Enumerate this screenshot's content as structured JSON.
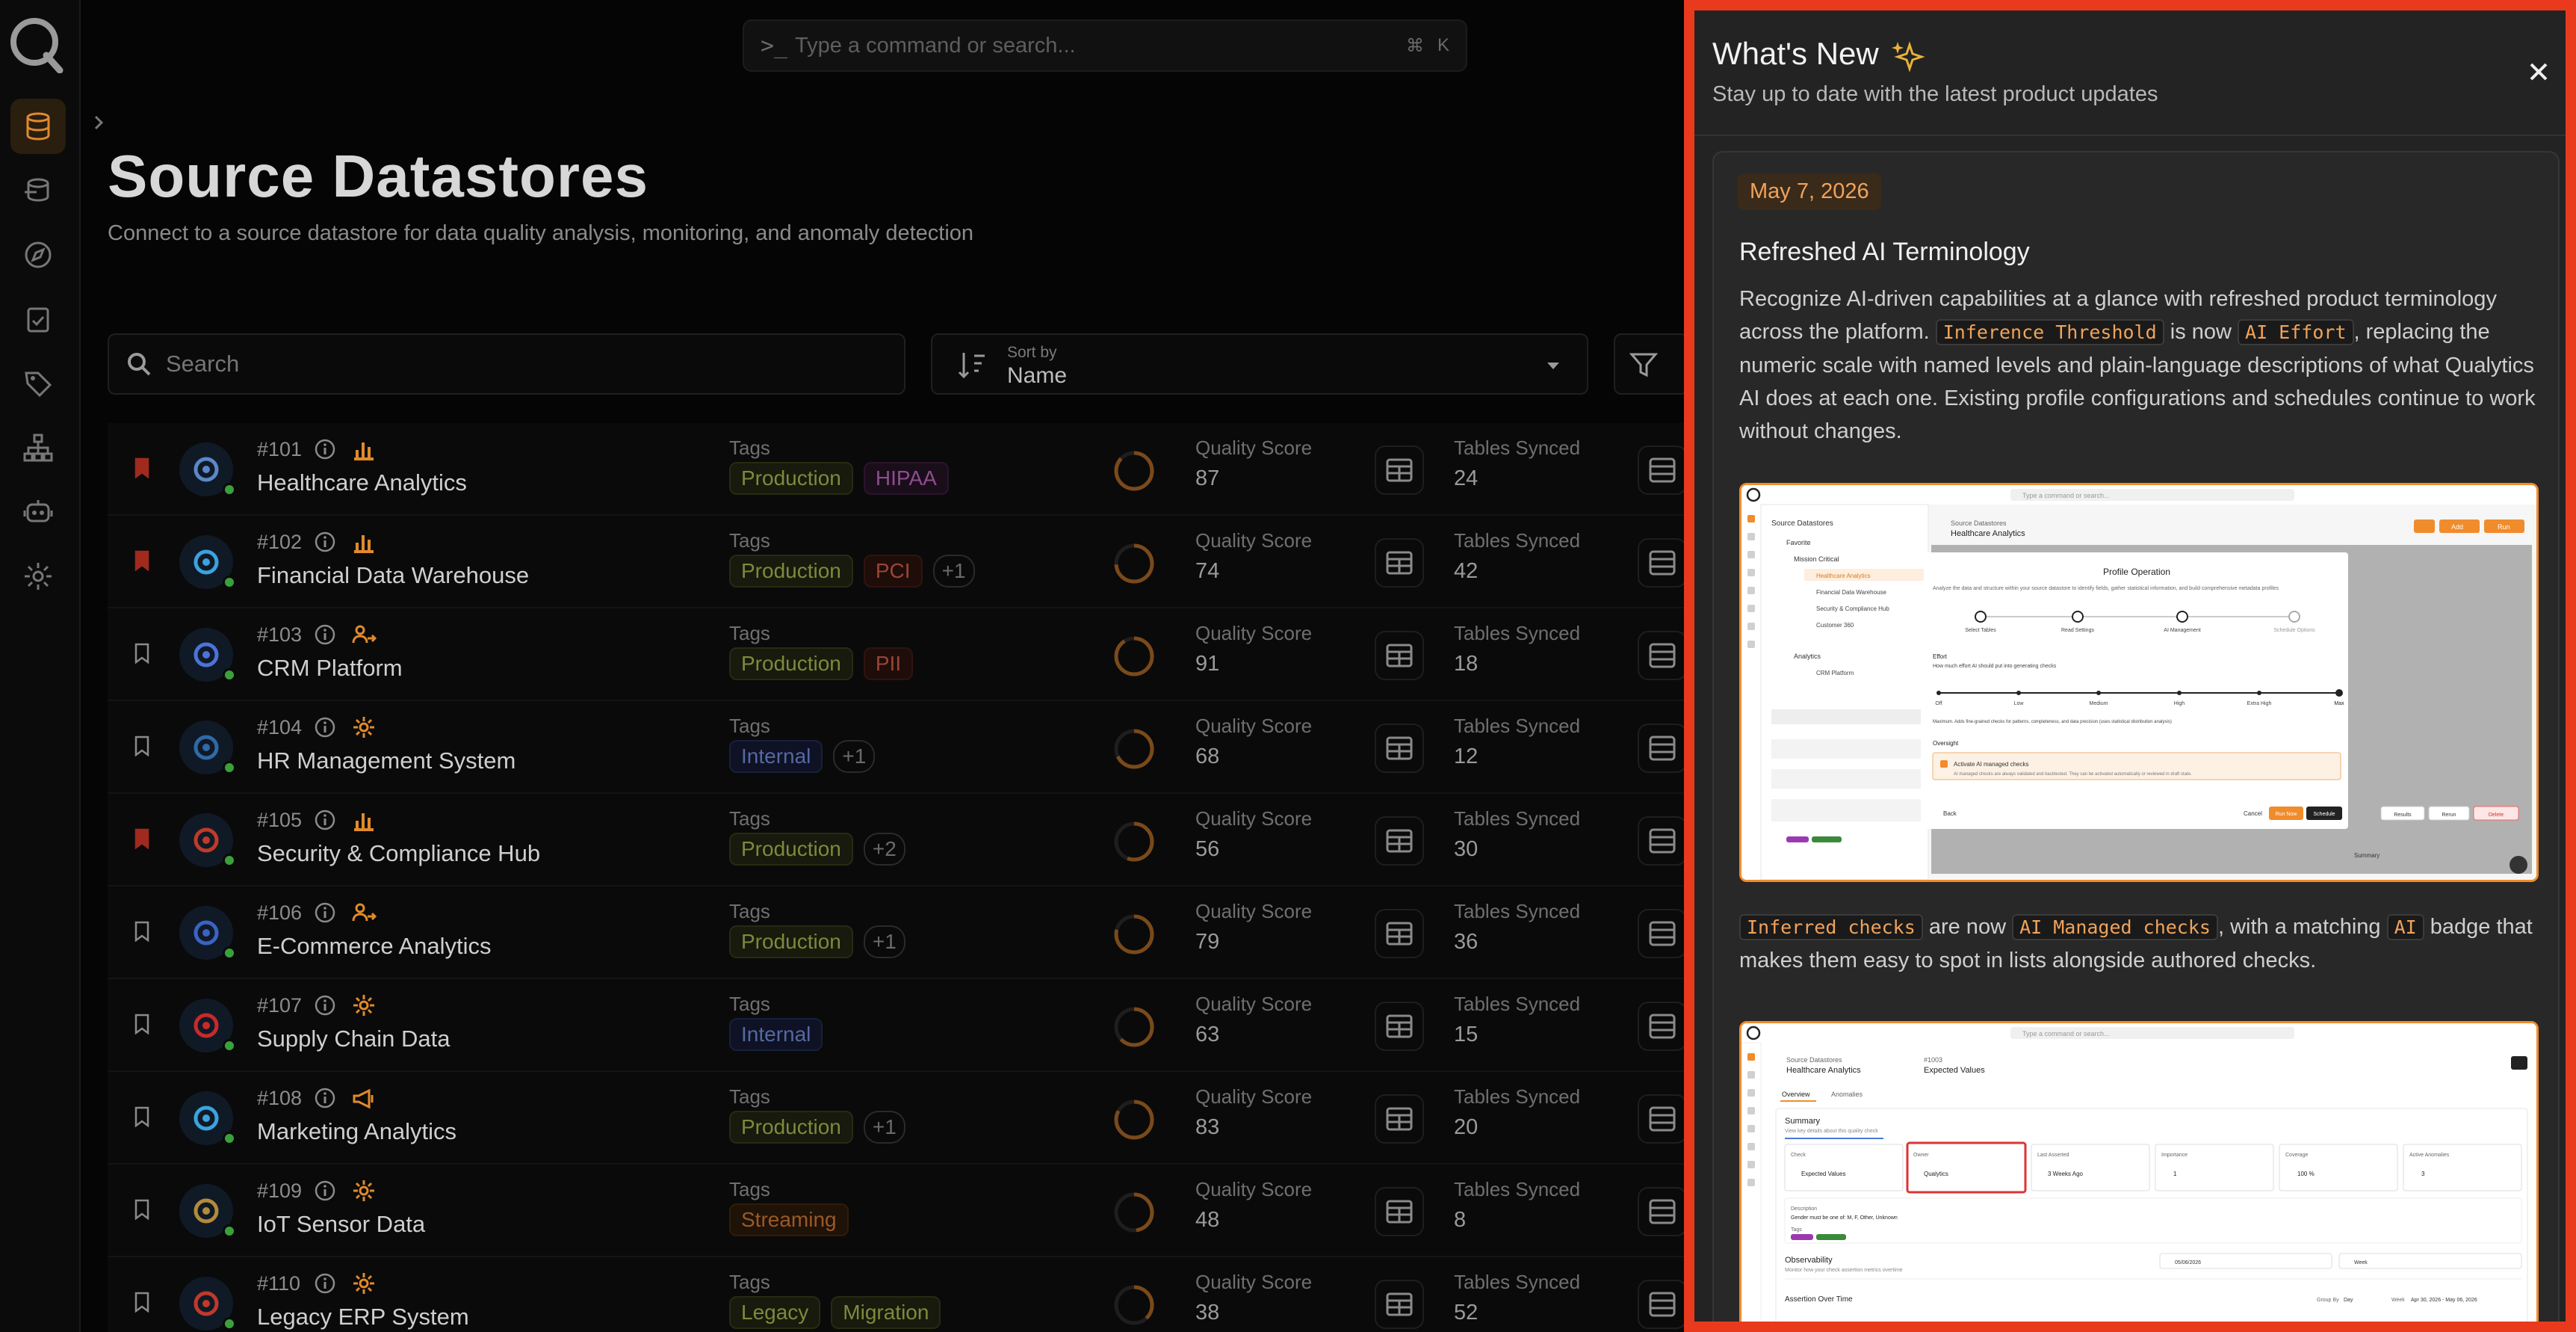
{
  "command_bar": {
    "placeholder": "Type a command or search...",
    "shortcut_mod": "⌘",
    "shortcut_key": "K"
  },
  "header": {
    "title": "Source Datastores",
    "subtitle": "Connect to a source datastore for data quality analysis, monitoring, and anomaly detection"
  },
  "filters": {
    "search_placeholder": "Search",
    "sort_label": "Sort by",
    "sort_value": "Name"
  },
  "labels": {
    "tags": "Tags",
    "quality": "Quality Score",
    "tables": "Tables Synced"
  },
  "datastores": [
    {
      "id": "#101",
      "name": "Healthcare Analytics",
      "bookmarked": true,
      "type_icon": "bar-chart",
      "tags": [
        [
          "Production",
          "green"
        ],
        [
          "HIPAA",
          "pink"
        ]
      ],
      "more": "",
      "quality": "87",
      "tables": "24",
      "logo_color": "#5a88c8"
    },
    {
      "id": "#102",
      "name": "Financial Data Warehouse",
      "bookmarked": true,
      "type_icon": "bar-chart",
      "tags": [
        [
          "Production",
          "green"
        ],
        [
          "PCI",
          "red"
        ]
      ],
      "more": "+1",
      "quality": "74",
      "tables": "42",
      "logo_color": "#3aa3e0"
    },
    {
      "id": "#103",
      "name": "CRM Platform",
      "bookmarked": false,
      "type_icon": "user-share",
      "tags": [
        [
          "Production",
          "green"
        ],
        [
          "PII",
          "red"
        ]
      ],
      "more": "",
      "quality": "91",
      "tables": "18",
      "logo_color": "#4b73d9"
    },
    {
      "id": "#104",
      "name": "HR Management System",
      "bookmarked": false,
      "type_icon": "gear",
      "tags": [
        [
          "Internal",
          "blue"
        ]
      ],
      "more": "+1",
      "quality": "68",
      "tables": "12",
      "logo_color": "#2f6aa8"
    },
    {
      "id": "#105",
      "name": "Security & Compliance Hub",
      "bookmarked": true,
      "type_icon": "bar-chart",
      "tags": [
        [
          "Production",
          "green"
        ]
      ],
      "more": "+2",
      "quality": "56",
      "tables": "30",
      "logo_color": "#c03a2a"
    },
    {
      "id": "#106",
      "name": "E-Commerce Analytics",
      "bookmarked": false,
      "type_icon": "user-share",
      "tags": [
        [
          "Production",
          "green"
        ]
      ],
      "more": "+1",
      "quality": "79",
      "tables": "36",
      "logo_color": "#3b63c4"
    },
    {
      "id": "#107",
      "name": "Supply Chain Data",
      "bookmarked": false,
      "type_icon": "gear",
      "tags": [
        [
          "Internal",
          "blue"
        ]
      ],
      "more": "",
      "quality": "63",
      "tables": "15",
      "logo_color": "#c82a2a"
    },
    {
      "id": "#108",
      "name": "Marketing Analytics",
      "bookmarked": false,
      "type_icon": "megaphone",
      "tags": [
        [
          "Production",
          "green"
        ]
      ],
      "more": "+1",
      "quality": "83",
      "tables": "20",
      "logo_color": "#3aa3e0"
    },
    {
      "id": "#109",
      "name": "IoT Sensor Data",
      "bookmarked": false,
      "type_icon": "gear",
      "tags": [
        [
          "Streaming",
          "orange"
        ]
      ],
      "more": "",
      "quality": "48",
      "tables": "8",
      "logo_color": "#b38b3a"
    },
    {
      "id": "#110",
      "name": "Legacy ERP System",
      "bookmarked": false,
      "type_icon": "gear",
      "tags": [
        [
          "Legacy",
          "green"
        ],
        [
          "Migration",
          "green"
        ]
      ],
      "more": "",
      "quality": "38",
      "tables": "52",
      "logo_color": "#c0392b"
    }
  ],
  "whats_new": {
    "title": "What's New",
    "subtitle": "Stay up to date with the latest product updates",
    "entry": {
      "date": "May 7, 2026",
      "title": "Refreshed AI Terminology",
      "p1": [
        {
          "t": "text",
          "v": "Recognize AI-driven capabilities at a glance with refreshed product terminology across the platform. "
        },
        {
          "t": "code",
          "v": "Inference Threshold"
        },
        {
          "t": "text",
          "v": " is now "
        },
        {
          "t": "code",
          "v": "AI Effort"
        },
        {
          "t": "text",
          "v": ", replacing the numeric scale with named levels and plain-language descriptions of what Qualytics AI does at each one. Existing profile configurations and schedules continue to work without changes."
        }
      ],
      "p2": [
        {
          "t": "code",
          "v": "Inferred checks"
        },
        {
          "t": "text",
          "v": " are now "
        },
        {
          "t": "code",
          "v": "AI Managed checks"
        },
        {
          "t": "text",
          "v": ", with a matching "
        },
        {
          "t": "code",
          "v": "AI"
        },
        {
          "t": "text",
          "v": " badge that makes them easy to spot in lists alongside authored checks."
        }
      ]
    },
    "shot1": {
      "search": "Type a command or search...",
      "crumb": "Source Datastores",
      "crumb_title": "Healthcare Analytics",
      "sidebar_title": "Source Datastores",
      "favorites": "Favorite",
      "group1": "Mission Critical",
      "items": [
        "Healthcare Analytics",
        "Financial Data Warehouse",
        "Security & Compliance Hub",
        "Customer 360"
      ],
      "group2": "Analytics",
      "group2_item": "CRM Platform",
      "modal_title": "Profile Operation",
      "modal_desc": "Analyze the data and structure within your source datastore to identify fields, gather statistical information, and build comprehensive metadata profiles",
      "steps": [
        "Select Tables",
        "Read Settings",
        "AI Management",
        "Schedule Options"
      ],
      "effort_label": "Effort",
      "effort_q": "How much effort AI should put into generating checks",
      "levels": [
        "Off",
        "Low",
        "Medium",
        "High",
        "Extra High",
        "Max"
      ],
      "max_note": "Maximum. Adds fine-grained checks for patterns, completeness, and data precision (uses statistical distribution analysis)",
      "oversight": "Oversight",
      "activate": "Activate AI managed checks",
      "activate_note": "AI managed checks are always validated and backtested. They can be activated automatically or reviewed in draft state.",
      "back": "Back",
      "cancel": "Cancel",
      "run_now": "Run Now",
      "schedule": "Schedule",
      "results": "Results",
      "rerun": "Rerun",
      "delete": "Delete",
      "add": "Add",
      "run": "Run",
      "summary": "Summary"
    },
    "shot2": {
      "search": "Type a command or search...",
      "crumb": "Source Datastores",
      "crumb_title": "Healthcare Analytics",
      "check_id": "#1003",
      "check_name": "Expected Values",
      "tab1": "Overview",
      "tab2": "Anomalies",
      "summary": "Summary",
      "summary_sub": "View key details about this quality check",
      "cols": [
        {
          "label": "Check",
          "value": "Expected Values"
        },
        {
          "label": "Owner",
          "value": "Qualytics"
        },
        {
          "label": "Last Asserted",
          "value": "3 Weeks Ago"
        },
        {
          "label": "Importance",
          "value": "1"
        },
        {
          "label": "Coverage",
          "value": "100 %"
        },
        {
          "label": "Active Anomalies",
          "value": "3"
        }
      ],
      "description_label": "Description",
      "description": "Gender must be one of: M, F, Other, Unknown",
      "tags_label": "Tags",
      "observability": "Observability",
      "obs_sub": "Monitor how your check assertion metrics overtime",
      "assertion": "Assertion Over Time",
      "group_by": "Group By",
      "group_val": "Day",
      "week": "Week",
      "date_range": "Apr 30, 2026 - May 06, 2026",
      "report_date": "05/06/2026",
      "timeframe": "Week"
    }
  }
}
